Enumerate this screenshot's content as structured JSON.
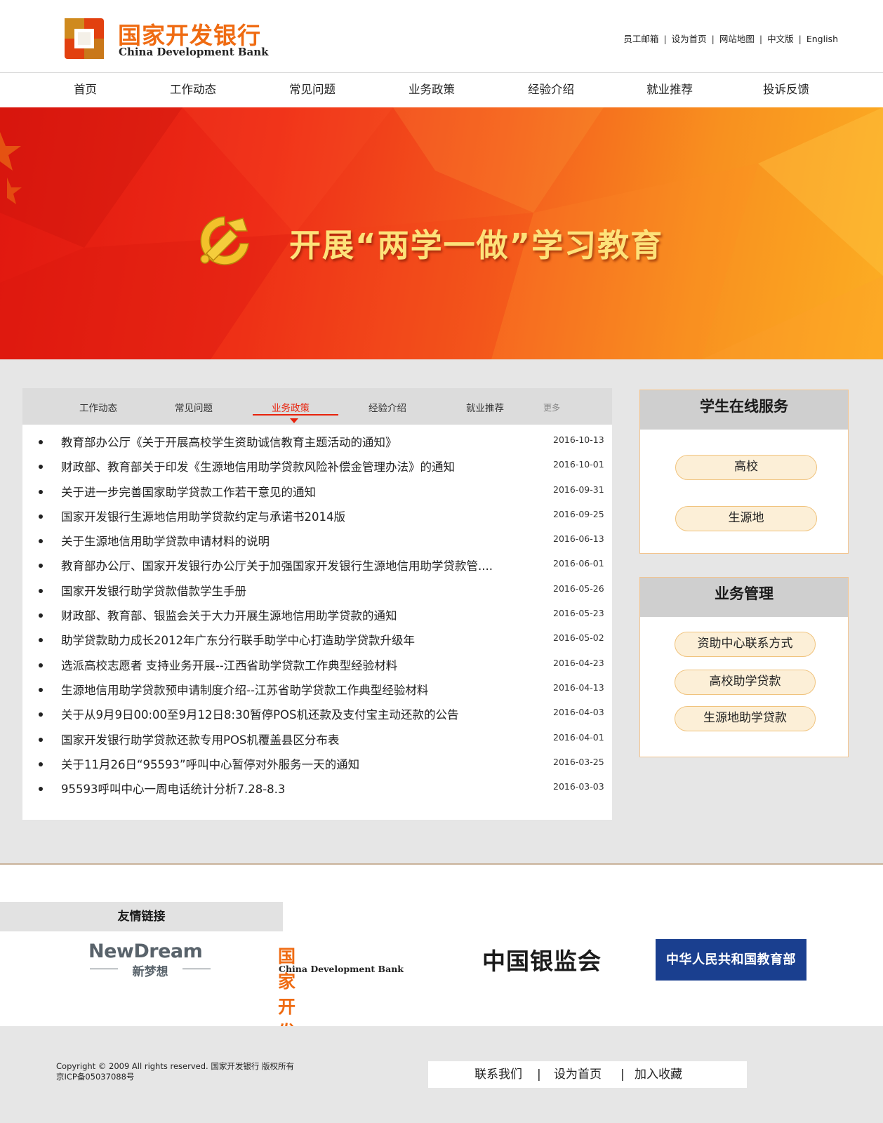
{
  "header": {
    "logo_cn": "国家开发银行",
    "logo_en": "China Development Bank",
    "toplinks": [
      "员工邮箱",
      "设为首页",
      "网站地图",
      "中文版",
      "English"
    ]
  },
  "nav": [
    "首页",
    "工作动态",
    "常见问题",
    "业务政策",
    "经验介绍",
    "就业推荐",
    "投诉反馈"
  ],
  "banner": {
    "title": "开展“两学一做”学习教育"
  },
  "news": {
    "tabs": [
      "工作动态",
      "常见问题",
      "业务政策",
      "经验介绍",
      "就业推荐"
    ],
    "active_tab": "业务政策",
    "more": "更多",
    "items": [
      {
        "title": "教育部办公厅《关于开展高校学生资助诚信教育主题活动的通知》",
        "date": "2016-10-13"
      },
      {
        "title": "财政部、教育部关于印发《生源地信用助学贷款风险补偿金管理办法》的通知",
        "date": "2016-10-01"
      },
      {
        "title": "关于进一步完善国家助学贷款工作若干意见的通知",
        "date": "2016-09-31"
      },
      {
        "title": "国家开发银行生源地信用助学贷款约定与承诺书2014版",
        "date": "2016-09-25"
      },
      {
        "title": "关于生源地信用助学贷款申请材料的说明",
        "date": "2016-06-13"
      },
      {
        "title": "教育部办公厅、国家开发银行办公厅关于加强国家开发银行生源地信用助学贷款管....",
        "date": "2016-06-01"
      },
      {
        "title": "国家开发银行助学贷款借款学生手册",
        "date": "2016-05-26"
      },
      {
        "title": "财政部、教育部、银监会关于大力开展生源地信用助学贷款的通知",
        "date": "2016-05-23"
      },
      {
        "title": "助学贷款助力成长2012年广东分行联手助学中心打造助学贷款升级年",
        "date": "2016-05-02"
      },
      {
        "title": "选派高校志愿者 支持业务开展--江西省助学贷款工作典型经验材料",
        "date": "2016-04-23"
      },
      {
        "title": "生源地信用助学贷款预申请制度介绍--江苏省助学贷款工作典型经验材料",
        "date": "2016-04-13"
      },
      {
        "title": "关于从9月9日00:00至9月12日8:30暂停POS机还款及支付宝主动还款的公告",
        "date": "2016-04-03"
      },
      {
        "title": "国家开发银行助学贷款还款专用POS机覆盖县区分布表",
        "date": "2016-04-01"
      },
      {
        "title": "关于11月26日“95593”呼叫中心暂停对外服务一天的通知",
        "date": "2016-03-25"
      },
      {
        "title": "95593呼叫中心一周电话统计分析7.28-8.3",
        "date": "2016-03-03"
      }
    ]
  },
  "student_service": {
    "title": "学生在线服务",
    "buttons": [
      "高校",
      "生源地"
    ]
  },
  "business": {
    "title": "业务管理",
    "buttons": [
      "资助中心联系方式",
      "高校助学贷款",
      "生源地助学贷款"
    ]
  },
  "links": {
    "title": "友情链接",
    "newdream": {
      "en": "NewDream",
      "cn": "新梦想"
    },
    "cdb": {
      "cn": "国家开发银行",
      "en": "China Development Bank"
    },
    "cbrc": "中国银监会",
    "moe": "中华人民共和国教育部"
  },
  "footer": {
    "copyright": "Copyright © 2009 All rights reserved. 国家开发银行 版权所有",
    "icp": "京ICP备05037088号",
    "links": [
      "联系我们",
      "设为首页",
      "加入收藏"
    ]
  },
  "colors": {
    "brand_orange": "#ef6b12",
    "active_red": "#e8220c",
    "pill_fill": "#fcefd7"
  }
}
